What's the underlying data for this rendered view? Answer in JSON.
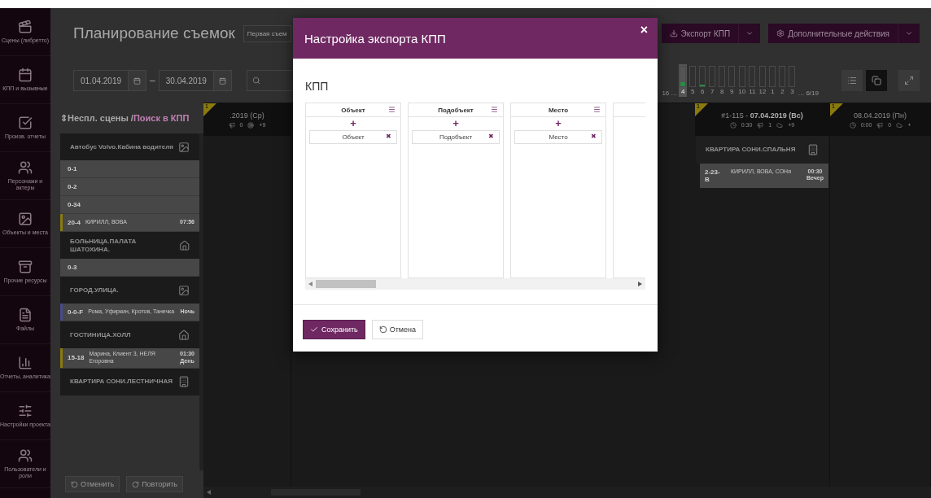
{
  "sidebar": {
    "items": [
      {
        "label": "Сцены (либретто)"
      },
      {
        "label": "КПП и вызывные"
      },
      {
        "label": "Произв. отчеты"
      },
      {
        "label": "Персонажи и актеры"
      },
      {
        "label": "Объекты и места"
      },
      {
        "label": "Прочие ресурсы"
      },
      {
        "label": "Файлы"
      },
      {
        "label": "Отчеты, аналитика"
      },
      {
        "label": "Настройки проекта"
      },
      {
        "label": "Пользователи и роли"
      }
    ]
  },
  "header": {
    "title": "Планирование съемок",
    "project_select": "Первая съем",
    "buttons": [
      "Экспорт КПП",
      "Дополнительные действия"
    ]
  },
  "filters": {
    "date_from": "01.04.2019",
    "separator": "–",
    "date_to": "30.04.2019"
  },
  "episodes": {
    "first": "16",
    "items": [
      {
        "label": "4",
        "selected": true,
        "level": 0.2
      },
      {
        "label": "5",
        "selected": false
      },
      {
        "label": "6",
        "selected": false,
        "level": 0.1
      },
      {
        "label": "7",
        "selected": false
      },
      {
        "label": "8",
        "selected": false
      },
      {
        "label": "9",
        "selected": false
      },
      {
        "label": "10",
        "selected": false
      },
      {
        "label": "11",
        "selected": false
      },
      {
        "label": "12",
        "selected": false
      },
      {
        "label": "1",
        "selected": false
      },
      {
        "label": "2",
        "selected": false
      },
      {
        "label": "3",
        "selected": false
      }
    ],
    "last": "6/19",
    "ellipsis": "…"
  },
  "unplanned": {
    "title": "⇕Неспл. сцены / ",
    "search_link": "Поиск в КПП",
    "items": [
      {
        "kind": "group",
        "title": "Автобус Volvo.Кабина водителя"
      },
      {
        "kind": "scene",
        "number": "0-1"
      },
      {
        "kind": "scene",
        "number": "0-2"
      },
      {
        "kind": "scene",
        "number": "0-34"
      },
      {
        "kind": "scene",
        "number": "20-4",
        "cast": "КИРИЛЛ, ВОВА",
        "time": "07:56",
        "color": "#8a7a10"
      },
      {
        "kind": "group",
        "title": "БОЛЬНИЦА.ПАЛАТА ШАТОХИНА."
      },
      {
        "kind": "scene",
        "number": "0-3"
      },
      {
        "kind": "group",
        "title": "ГОРОД.УЛИЦА."
      },
      {
        "kind": "scene",
        "number": "0-0-F",
        "cast": "Рома, Уфиркин, Кротов, Танечка",
        "period": "Ночь",
        "color": "#4a4a8a"
      },
      {
        "kind": "group",
        "title": "ГОСТИНИЦА.ХОЛЛ"
      },
      {
        "kind": "scene",
        "number": "15-18",
        "cast": "Марина, Клиент 3, НЕЛЯ Егоровна",
        "time": "01:30",
        "period": "День",
        "color": "#8a7a10"
      },
      {
        "kind": "group",
        "title": "КВАРТИРА СОНИ.ЛЕСТНИЧНАЯ"
      }
    ],
    "undo": "Отменить",
    "redo": "Повторить"
  },
  "timeline": {
    "days": [
      {
        "title": ".2019 (Ср)",
        "stats": [
          "0",
          "+9"
        ],
        "badge": "1"
      },
      {
        "title": "#1-115 - **07.04.2019 (Вс)**",
        "stats": [
          "0:30",
          "1",
          "+9"
        ],
        "badge": "1",
        "cards": [
          {
            "title": "КВАРТИРА СОНИ.СПАЛЬНЯ",
            "scene": {
              "number": "2-23-В",
              "cast": "КИРИЛЛ, ВОВА, СОНя",
              "time": "00:30",
              "period": "Вечер"
            }
          }
        ]
      },
      {
        "title": "08.04.2019 (Пн)",
        "stats": [
          "0:00",
          "0",
          "+"
        ],
        "badge": "1"
      }
    ]
  },
  "modal": {
    "title": "Настройка экспорта КПП",
    "close": "×",
    "section": "КПП",
    "columns": [
      {
        "title": "Объект",
        "add": "+",
        "chip": "Объект",
        "remove": "✖"
      },
      {
        "title": "Подобъект",
        "add": "+",
        "chip": "Подобъект",
        "remove": "✖"
      },
      {
        "title": "Место",
        "add": "+",
        "chip": "Место",
        "remove": "✖"
      }
    ],
    "save": "Сохранить",
    "cancel": "Отмена"
  }
}
